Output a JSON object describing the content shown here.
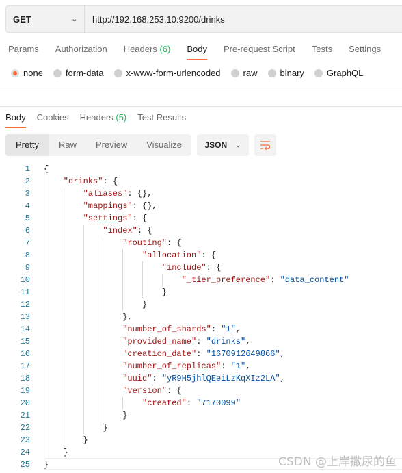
{
  "request": {
    "method": "GET",
    "url": "http://192.168.253.10:9200/drinks"
  },
  "request_tabs": [
    {
      "label": "Params"
    },
    {
      "label": "Authorization"
    },
    {
      "label": "Headers",
      "count": "(6)"
    },
    {
      "label": "Body",
      "active": true
    },
    {
      "label": "Pre-request Script"
    },
    {
      "label": "Tests"
    },
    {
      "label": "Settings"
    }
  ],
  "body_types": [
    {
      "label": "none",
      "selected": true
    },
    {
      "label": "form-data"
    },
    {
      "label": "x-www-form-urlencoded"
    },
    {
      "label": "raw"
    },
    {
      "label": "binary"
    },
    {
      "label": "GraphQL"
    }
  ],
  "response_tabs": [
    {
      "label": "Body",
      "active": true
    },
    {
      "label": "Cookies"
    },
    {
      "label": "Headers",
      "count": "(5)"
    },
    {
      "label": "Test Results"
    }
  ],
  "view_modes": [
    "Pretty",
    "Raw",
    "Preview",
    "Visualize"
  ],
  "format": "JSON",
  "accent": "#ff6c37",
  "code_lines": [
    {
      "i": 0,
      "t": "{"
    },
    {
      "i": 1,
      "t": "\"drinks\": {"
    },
    {
      "i": 2,
      "t": "\"aliases\": {},"
    },
    {
      "i": 2,
      "t": "\"mappings\": {},"
    },
    {
      "i": 2,
      "t": "\"settings\": {"
    },
    {
      "i": 3,
      "t": "\"index\": {"
    },
    {
      "i": 4,
      "t": "\"routing\": {"
    },
    {
      "i": 5,
      "t": "\"allocation\": {"
    },
    {
      "i": 6,
      "t": "\"include\": {"
    },
    {
      "i": 7,
      "t": "\"_tier_preference\": \"data_content\""
    },
    {
      "i": 6,
      "t": "}"
    },
    {
      "i": 5,
      "t": "}"
    },
    {
      "i": 4,
      "t": "},"
    },
    {
      "i": 4,
      "t": "\"number_of_shards\": \"1\","
    },
    {
      "i": 4,
      "t": "\"provided_name\": \"drinks\","
    },
    {
      "i": 4,
      "t": "\"creation_date\": \"1670912649866\","
    },
    {
      "i": 4,
      "t": "\"number_of_replicas\": \"1\","
    },
    {
      "i": 4,
      "t": "\"uuid\": \"yR9H5jhlQEeiLzKqXIz2LA\","
    },
    {
      "i": 4,
      "t": "\"version\": {"
    },
    {
      "i": 5,
      "t": "\"created\": \"7170099\""
    },
    {
      "i": 4,
      "t": "}"
    },
    {
      "i": 3,
      "t": "}"
    },
    {
      "i": 2,
      "t": "}"
    },
    {
      "i": 1,
      "t": "}"
    },
    {
      "i": 0,
      "t": "}"
    }
  ],
  "watermark": "CSDN @上岸撒尿的鱼"
}
